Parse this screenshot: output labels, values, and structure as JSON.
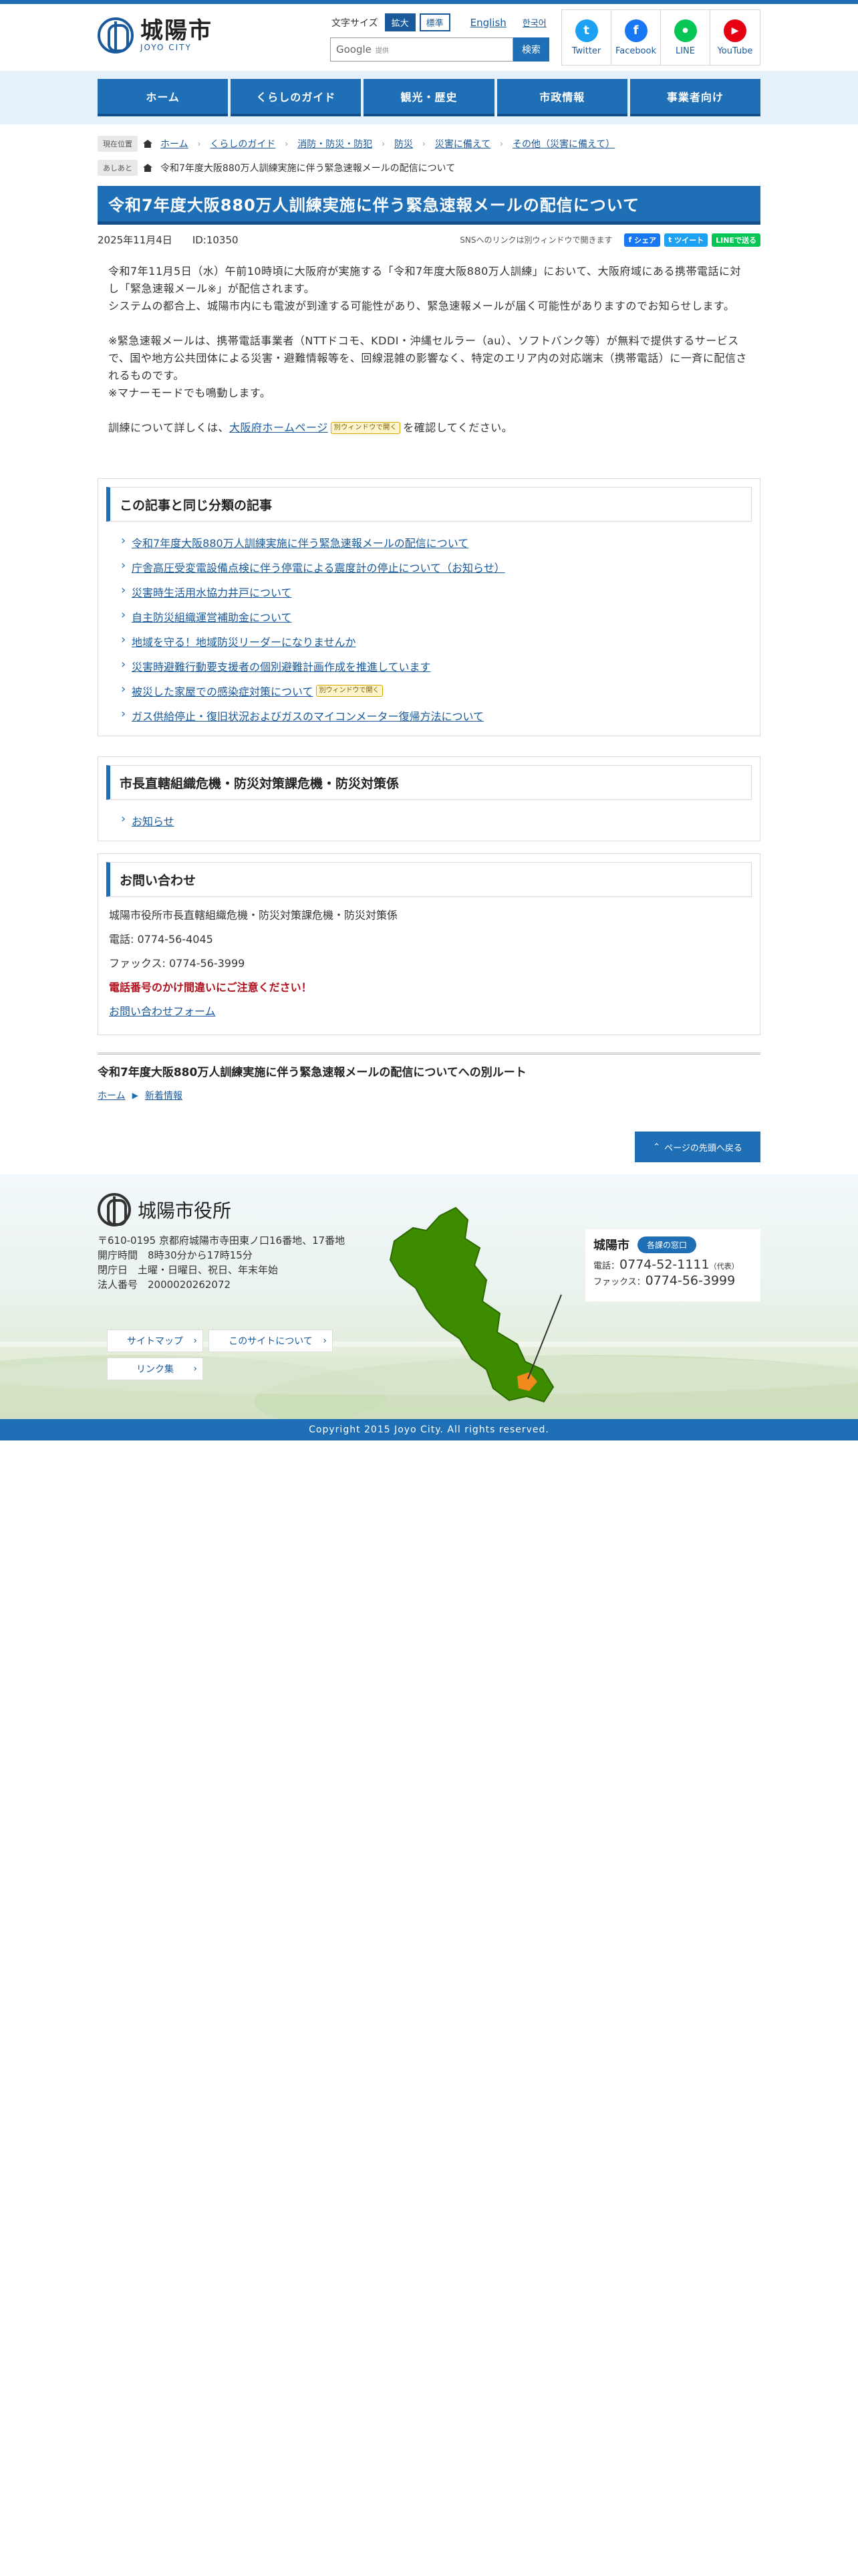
{
  "header": {
    "logo_name": "城陽市",
    "logo_sub": "JOYO CITY",
    "font_size_label": "文字サイズ",
    "font_size_large": "拡大",
    "font_size_standard": "標準",
    "lang_english": "English",
    "lang_korean": "한국어",
    "search_brand": "Google",
    "search_note": "提供",
    "search_button": "検索",
    "sns": [
      {
        "label": "Twitter",
        "icon": "twitter-icon",
        "color": "#1da1f2"
      },
      {
        "label": "Facebook",
        "icon": "facebook-icon",
        "color": "#1877f2"
      },
      {
        "label": "LINE",
        "icon": "line-icon",
        "color": "#06c755"
      },
      {
        "label": "YouTube",
        "icon": "youtube-icon",
        "color": "#e60012"
      }
    ]
  },
  "gnav": [
    "ホーム",
    "くらしのガイド",
    "観光・歴史",
    "市政情報",
    "事業者向け"
  ],
  "breadcrumb": {
    "current_tag": "現在位置",
    "items": [
      "ホーム",
      "くらしのガイド",
      "消防・防災・防犯",
      "防災",
      "災害に備えて",
      "その他（災害に備えて）"
    ],
    "trail_tag": "あしあと",
    "trail_item": "令和7年度大阪880万人訓練実施に伴う緊急速報メールの配信について"
  },
  "article": {
    "title": "令和7年度大阪880万人訓練実施に伴う緊急速報メールの配信について",
    "date": "2025年11月4日",
    "id": "ID:10350",
    "sns_note": "SNSへのリンクは別ウィンドウで開きます",
    "share_fb": "シェア",
    "share_tw": "ツイート",
    "share_line": "LINEで送る",
    "p1": "令和7年11月5日（水）午前10時頃に大阪府が実施する「令和7年度大阪880万人訓練」において、大阪府域にある携帯電話に対し「緊急速報メール※」が配信されます。",
    "p1b": "システムの都合上、城陽市内にも電波が到達する可能性があり、緊急速報メールが届く可能性がありますのでお知らせします。",
    "p2": "※緊急速報メールは、携帯電話事業者（NTTドコモ、KDDI・沖縄セルラー（au）、ソフトバンク等）が無料で提供するサービスで、国や地方公共団体による災害・避難情報等を、回線混雑の影響なく、特定のエリア内の対応端末（携帯電話）に一斉に配信されるものです。",
    "p2b": "※マナーモードでも鳴動します。",
    "p3_pre": "訓練について詳しくは、",
    "p3_link": "大阪府ホームページ",
    "p3_badge": "別ウィンドウで開く",
    "p3_post": "を確認してください。"
  },
  "related": {
    "heading": "この記事と同じ分類の記事",
    "items": [
      {
        "label": "令和7年度大阪880万人訓練実施に伴う緊急速報メールの配信について"
      },
      {
        "label": "庁舎高圧受変電設備点検に伴う停電による震度計の停止について（お知らせ）"
      },
      {
        "label": "災害時生活用水協力井戸について"
      },
      {
        "label": "自主防災組織運営補助金について"
      },
      {
        "label": "地域を守る！地域防災リーダーになりませんか"
      },
      {
        "label": "災害時避難行動要支援者の個別避難計画作成を推進しています"
      },
      {
        "label": "被災した家屋での感染症対策について",
        "badge": "別ウィンドウで開く"
      },
      {
        "label": "ガス供給停止・復旧状況およびガスのマイコンメーター復帰方法について"
      }
    ]
  },
  "dept": {
    "heading": "市長直轄組織危機・防災対策課危機・防災対策係",
    "link": "お知らせ"
  },
  "contact": {
    "heading": "お問い合わせ",
    "org": "城陽市役所市長直轄組織危機・防災対策課危機・防災対策係",
    "tel": "電話: 0774-56-4045",
    "fax": "ファックス: 0774-56-3999",
    "warn": "電話番号のかけ間違いにご注意ください！",
    "form": "お問い合わせフォーム"
  },
  "other_route": {
    "title": "令和7年度大阪880万人訓練実施に伴う緊急速報メールの配信についてへの別ルート",
    "home": "ホーム",
    "news": "新着情報"
  },
  "pagetop": "ページの先頭へ戻る",
  "footer": {
    "logo": "城陽市役所",
    "address": "〒610-0195 京都府城陽市寺田東ノ口16番地、17番地",
    "hours": "開庁時間　8時30分から17時15分",
    "closed": "閉庁日　土曜・日曜日、祝日、年末年始",
    "corp": "法人番号　2000020262072",
    "links": [
      "サイトマップ",
      "このサイトについて",
      "リンク集"
    ],
    "card_city": "城陽市",
    "card_tag": "各課の窓口",
    "tel_label": "電話：",
    "tel": "0774-52-1111",
    "tel_note": "（代表）",
    "fax_label": "ファックス：",
    "fax": "0774-56-3999",
    "copyright": "Copyright 2015 Joyo City. All rights reserved."
  }
}
